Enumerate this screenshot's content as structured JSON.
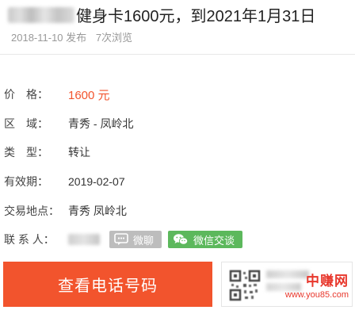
{
  "listing": {
    "title_text": "健身卡1600元，到2021年1月31日",
    "published_date": "2018-11-10",
    "published_label": "发布",
    "views": "7次浏览"
  },
  "details": {
    "price_label": "价　格：",
    "price_value": "1600 元",
    "area_label": "区　域：",
    "area_value": "青秀 - 凤岭北",
    "type_label": "类　型：",
    "type_value": "转让",
    "validity_label": "有效期：",
    "validity_value": "2019-02-07",
    "location_label": "交易地点：",
    "location_value": "青秀 凤岭北",
    "contact_label": "联 系 人："
  },
  "actions": {
    "weiliao_label": "微聊",
    "wechat_label": "微信交谈",
    "call_label": "查看电话号码"
  },
  "watermark": {
    "cn": "中赚网",
    "url": "www.you85.com"
  },
  "colors": {
    "accent": "#f2542d",
    "wechat_green": "#5cb85c",
    "weiliao_gray": "#bdbdbd"
  }
}
